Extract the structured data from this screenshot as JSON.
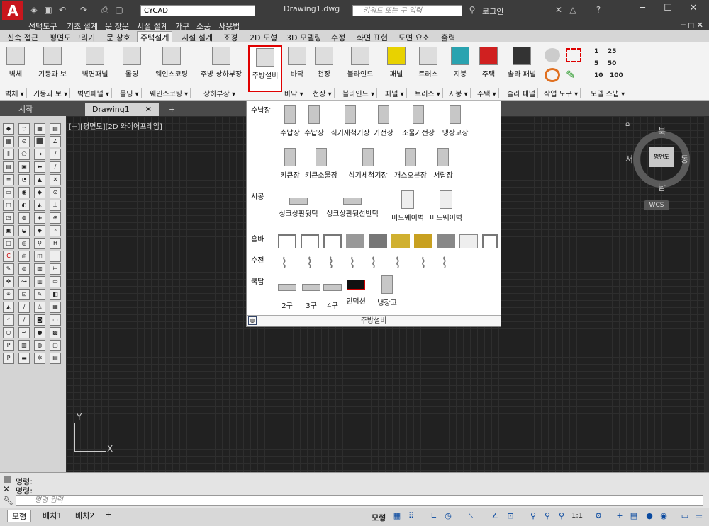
{
  "titlebar": {
    "app_logo": "A",
    "workspace": "CYCAD",
    "document": "Drawing1.dwg",
    "keyword_placeholder": "키워드 또는 구 입력",
    "login": "로그인",
    "help": "?"
  },
  "menubar": {
    "items": [
      "선택도구",
      "기초 설계",
      "문 장문",
      "시설 설계",
      "가구",
      "소품",
      "사용법"
    ]
  },
  "ribbon_tabs": {
    "items": [
      "신속 접근",
      "평면도 그리기",
      "문 창호",
      "주택설계",
      "시설 설계",
      "조경",
      "2D 도형",
      "3D 모델링",
      "수정",
      "화면 표현",
      "도면 요소",
      "출력"
    ],
    "active_index": 3
  },
  "ribbon": {
    "buttons": [
      "벽체",
      "기둥과 보",
      "벽면패널",
      "몰딩",
      "웨인스코팅",
      "주방 상하부장",
      "주방설비",
      "바닥",
      "천장",
      "블라인드",
      "패널",
      "트러스",
      "지붕",
      "주택",
      "솔라 패널"
    ],
    "selected_index": 6,
    "groups": [
      "벽체 ▾",
      "기둥과 보 ▾",
      "벽면패널 ▾",
      "몰딩 ▾",
      "웨인스코팅 ▾",
      "상하부장 ▾",
      "바닥 ▾",
      "천장 ▾",
      "블라인드 ▾",
      "패널 ▾",
      "트러스 ▾",
      "지붕 ▾",
      "주택 ▾",
      "솔라 패널",
      "작업 도구 ▾",
      "모델 스냅 ▾"
    ],
    "snap_values": [
      "1",
      "25",
      "5",
      "50",
      "10",
      "100"
    ]
  },
  "doctabs": {
    "items": [
      "시작",
      "Drawing1",
      "+"
    ],
    "active_index": 1
  },
  "viewport": {
    "label": "[−][평면도][2D 와이어프레임]"
  },
  "viewcube": {
    "north": "북",
    "south": "남",
    "east": "동",
    "west": "서",
    "face": "평면도",
    "wcs": "WCS"
  },
  "axes": {
    "x": "X",
    "y": "Y"
  },
  "dropdown": {
    "title": "주방설비",
    "sections": [
      {
        "name": "수납장",
        "items": [
          "수납장",
          "수납장",
          "식기세척기장",
          "가전장",
          "소물가전장",
          "냉장고장"
        ]
      },
      {
        "name": "",
        "items": [
          "키큰장",
          "키큰소물장",
          "식기세척기장",
          "개스오븐장",
          "서랍장"
        ]
      },
      {
        "name": "시공",
        "items": [
          "싱크상판뒷턱",
          "싱크상판뒷선반턱",
          "미드웨이벽",
          "미드웨이벽"
        ]
      },
      {
        "name": "홈바",
        "items": []
      },
      {
        "name": "수전",
        "items": []
      },
      {
        "name": "쿡탑",
        "items": [
          "2구",
          "3구",
          "4구",
          "인덕션",
          "냉장고"
        ]
      }
    ]
  },
  "command": {
    "history": [
      "명령:",
      "명령:"
    ],
    "placeholder": "명령 입력"
  },
  "status": {
    "layout_tabs": [
      "모형",
      "배치1",
      "배치2",
      "+"
    ],
    "active_index": 0,
    "model_label": "모형",
    "scale": "1:1"
  }
}
